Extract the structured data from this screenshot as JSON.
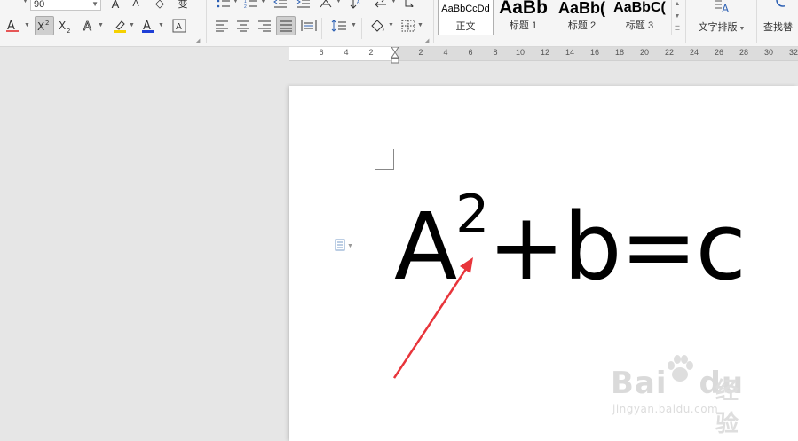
{
  "toolbar": {
    "font_size_value": "90",
    "buttons": {
      "grow_font": "A",
      "shrink_font": "A",
      "clear_format": "◇",
      "phonetic": "变",
      "font_color_a": "A",
      "superscript": "X²",
      "subscript": "X₂",
      "text_effect": "A",
      "highlight": "✎",
      "font_color": "A",
      "char_border": "A"
    }
  },
  "styles": [
    {
      "sample": "AaBbCcDd",
      "label": "正文",
      "selected": true
    },
    {
      "sample": "AaBb",
      "label": "标题 1",
      "selected": false
    },
    {
      "sample": "AaBb(",
      "label": "标题 2",
      "selected": false
    },
    {
      "sample": "AaBbC(",
      "label": "标题 3",
      "selected": false
    }
  ],
  "big_buttons": {
    "text_layout": "文字排版",
    "find_replace": "查找替"
  },
  "ruler": {
    "left_labels": [
      "6",
      "4",
      "2"
    ],
    "right_labels": [
      "2",
      "4",
      "6",
      "8",
      "10",
      "12",
      "14",
      "16",
      "18",
      "20",
      "22",
      "24",
      "26",
      "28",
      "30",
      "32"
    ]
  },
  "document": {
    "base": "A",
    "exponent": "2",
    "rest": "+b=c"
  },
  "watermark": {
    "brand": "Bai",
    "brand2": "du",
    "cn": "经验",
    "url": "jingyan.baidu.com"
  },
  "colors": {
    "arrow": "#e8353b",
    "highlight": "#f5d100",
    "font_color_bar": "#1e3fd6",
    "red_underline": "#e02020"
  }
}
